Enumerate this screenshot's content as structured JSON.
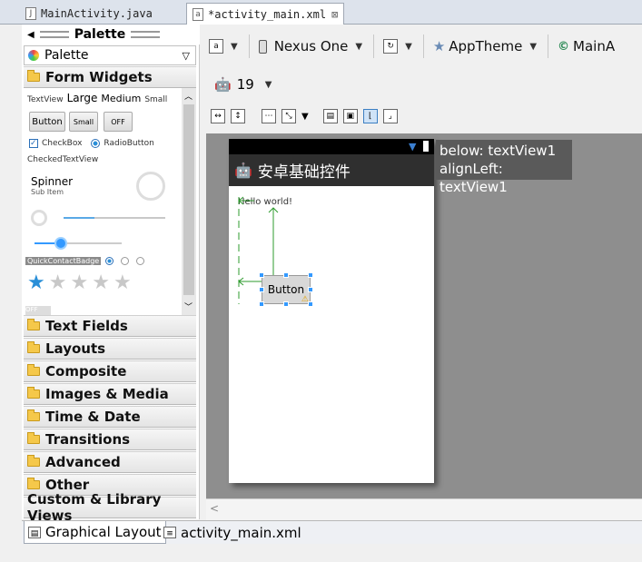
{
  "editor_tabs": [
    {
      "label": "MainActivity.java",
      "icon": "java-file-icon",
      "active": false
    },
    {
      "label": "*activity_main.xml",
      "icon": "xml-file-icon",
      "active": true,
      "close": "⊠"
    }
  ],
  "palette": {
    "title": "Palette",
    "selector_label": "Palette",
    "form_widgets_label": "Form Widgets",
    "widgets": {
      "textview": "TextView",
      "large": "Large",
      "medium": "Medium",
      "small": "Small",
      "button": "Button",
      "button_small": "Small",
      "toggle_off": "OFF",
      "checkbox": "CheckBox",
      "radiobutton": "RadioButton",
      "checkedtextview": "CheckedTextView",
      "spinner": "Spinner",
      "spinner_sub": "Sub Item",
      "quickcontactbadge": "QuickContactBadge",
      "switch_off": "OFF",
      "rating_value": 1,
      "rating_max": 5
    },
    "categories": [
      "Text Fields",
      "Layouts",
      "Composite",
      "Images & Media",
      "Time & Date",
      "Transitions",
      "Advanced",
      "Other"
    ],
    "custom_label": "Custom & Library Views"
  },
  "toolbar": {
    "device": "Nexus One",
    "theme": "AppTheme",
    "activity": "MainA",
    "api_level": "19"
  },
  "preview": {
    "app_title": "安卓基础控件",
    "hello_text": "Hello world!",
    "button_text": "Button",
    "tooltip_line1": "below: textView1",
    "tooltip_line2": "alignLeft: textView1"
  },
  "bottom_tabs": {
    "graphical": "Graphical Layout",
    "xml": "activity_main.xml"
  },
  "colors": {
    "accent": "#3399ff",
    "guide": "#2e9b2e",
    "star_selected": "#2a8fd8",
    "star_empty": "#c8c8c8"
  }
}
